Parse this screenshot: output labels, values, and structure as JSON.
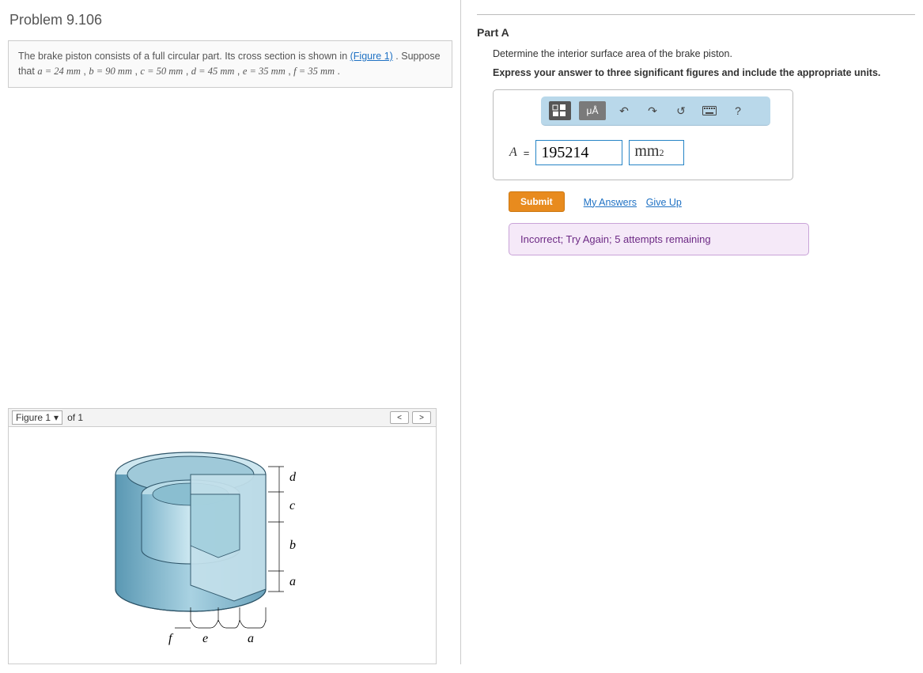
{
  "problem": {
    "title": "Problem 9.106",
    "text1": "The brake piston consists of a full circular part. Its cross section is shown in ",
    "figure_link": "(Figure 1)",
    "text2": " . Suppose that ",
    "vars": {
      "a": "a = 24  mm",
      "b": "b = 90  mm",
      "c": "c = 50  mm",
      "d": "d = 45  mm",
      "e": "e = 35  mm",
      "f": "f = 35  mm"
    },
    "sep": " , ",
    "end": " ."
  },
  "figure": {
    "selector": "Figure 1",
    "of": "of 1",
    "labels": {
      "a_top": "a",
      "b": "b",
      "c": "c",
      "d": "d",
      "f": "f",
      "e_bot": "e",
      "a_bot": "a"
    }
  },
  "partA": {
    "heading": "Part A",
    "instruction": "Determine the interior surface area of the brake piston.",
    "bold_instruction": "Express your answer to three significant figures and include the appropriate units.",
    "toolbar": {
      "units_btn": "μÅ",
      "help": "?"
    },
    "answer": {
      "label": "A",
      "equals": "=",
      "value": "195214",
      "units_base": "mm",
      "units_exp": "2"
    },
    "submit": "Submit",
    "my_answers": "My Answers",
    "give_up": "Give Up",
    "feedback": "Incorrect; Try Again; 5 attempts remaining"
  }
}
